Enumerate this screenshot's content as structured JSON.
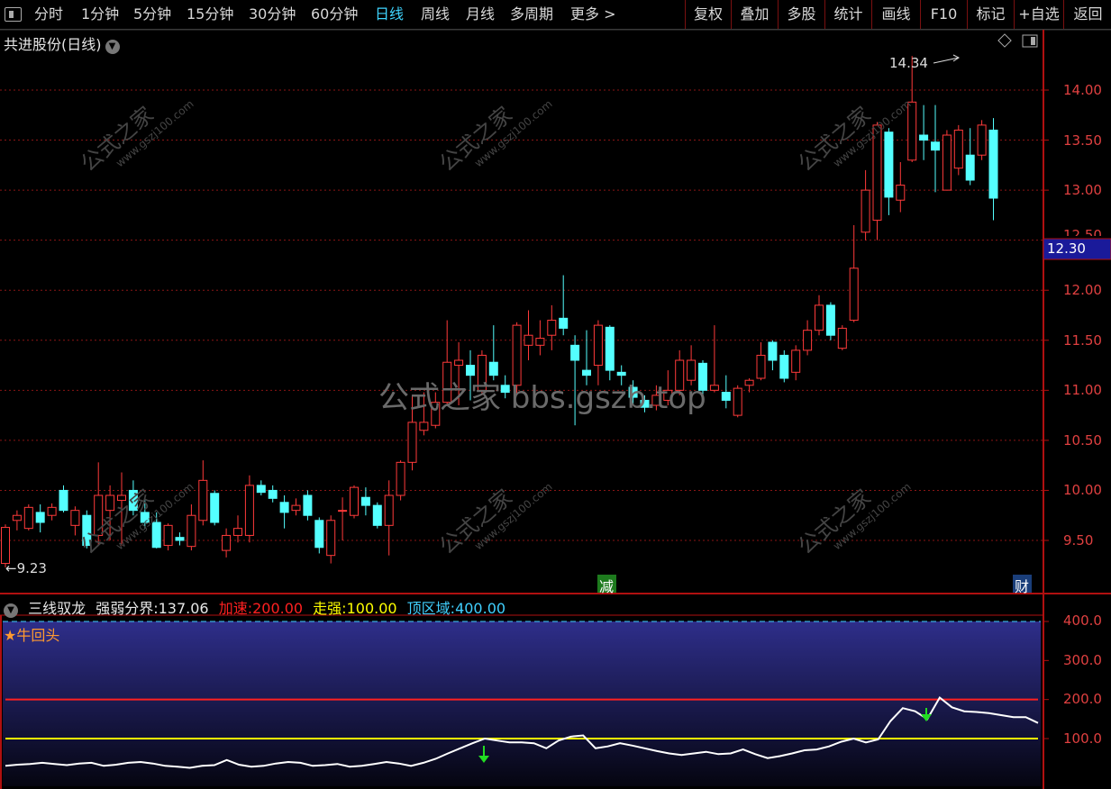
{
  "toolbar": {
    "periods": [
      "分时",
      "1分钟",
      "5分钟",
      "15分钟",
      "30分钟",
      "60分钟",
      "日线",
      "周线",
      "月线",
      "多周期",
      "更多 >"
    ],
    "active_period": "日线",
    "right_buttons": [
      "复权",
      "叠加",
      "多股",
      "统计",
      "画线",
      "F10",
      "标记",
      "+自选",
      "返回"
    ]
  },
  "main_chart": {
    "stock_name": "共进股份(日线)",
    "high_label": "14.34",
    "low_label": "←9.23",
    "current_price_tag": "12.30",
    "event_tag_jian": "减",
    "event_tag_cai": "财",
    "price_axis": [
      "14.00",
      "13.50",
      "13.00",
      "12.50",
      "12.00",
      "11.50",
      "11.00",
      "10.50",
      "10.00",
      "9.50"
    ],
    "watermark_center": "公式之家 bbs.gszb.top",
    "watermark_tile": "公式之家",
    "watermark_tile_url": "www.gszj100.com"
  },
  "indicator": {
    "name": "三线驭龙",
    "items": [
      {
        "label": "强弱分界:",
        "value": "137.06",
        "color": "#e8e8e8"
      },
      {
        "label": "加速:",
        "value": "200.00",
        "color": "#ff2020"
      },
      {
        "label": "走强:",
        "value": "100.00",
        "color": "#ffff00"
      },
      {
        "label": "顶区域:",
        "value": "400.00",
        "color": "#40d0ff"
      }
    ],
    "signal_label": "★牛回头",
    "axis": [
      "400.0",
      "300.0",
      "200.0",
      "100.0"
    ]
  },
  "chart_data": {
    "type": "candlestick",
    "ylim": [
      9.1,
      14.5
    ],
    "candles": [
      {
        "o": 9.27,
        "c": 9.63,
        "h": 9.66,
        "l": 9.23
      },
      {
        "o": 9.7,
        "c": 9.75,
        "h": 9.8,
        "l": 9.6
      },
      {
        "o": 9.62,
        "c": 9.83,
        "h": 9.86,
        "l": 9.6
      },
      {
        "o": 9.78,
        "c": 9.68,
        "h": 9.86,
        "l": 9.58
      },
      {
        "o": 9.75,
        "c": 9.83,
        "h": 9.87,
        "l": 9.7
      },
      {
        "o": 10.0,
        "c": 9.8,
        "h": 10.05,
        "l": 9.78
      },
      {
        "o": 9.65,
        "c": 9.8,
        "h": 9.84,
        "l": 9.55
      },
      {
        "o": 9.75,
        "c": 9.45,
        "h": 9.8,
        "l": 9.42
      },
      {
        "o": 9.55,
        "c": 9.95,
        "h": 10.28,
        "l": 9.45
      },
      {
        "o": 9.8,
        "c": 9.95,
        "h": 10.05,
        "l": 9.5
      },
      {
        "o": 9.9,
        "c": 9.95,
        "h": 10.18,
        "l": 9.45
      },
      {
        "o": 10.0,
        "c": 9.8,
        "h": 10.1,
        "l": 9.75
      },
      {
        "o": 9.78,
        "c": 9.68,
        "h": 9.9,
        "l": 9.62
      },
      {
        "o": 9.68,
        "c": 9.43,
        "h": 9.78,
        "l": 9.42
      },
      {
        "o": 9.45,
        "c": 9.65,
        "h": 9.67,
        "l": 9.4
      },
      {
        "o": 9.53,
        "c": 9.5,
        "h": 9.58,
        "l": 9.45
      },
      {
        "o": 9.44,
        "c": 9.75,
        "h": 9.86,
        "l": 9.4
      },
      {
        "o": 9.7,
        "c": 10.1,
        "h": 10.3,
        "l": 9.65
      },
      {
        "o": 9.97,
        "c": 9.68,
        "h": 10.0,
        "l": 9.65
      },
      {
        "o": 9.4,
        "c": 9.55,
        "h": 9.62,
        "l": 9.33
      },
      {
        "o": 9.55,
        "c": 9.62,
        "h": 9.75,
        "l": 9.48
      },
      {
        "o": 9.55,
        "c": 10.05,
        "h": 10.15,
        "l": 9.48
      },
      {
        "o": 10.05,
        "c": 9.98,
        "h": 10.1,
        "l": 9.95
      },
      {
        "o": 10.0,
        "c": 9.92,
        "h": 10.05,
        "l": 9.88
      },
      {
        "o": 9.88,
        "c": 9.78,
        "h": 9.95,
        "l": 9.62
      },
      {
        "o": 9.8,
        "c": 9.85,
        "h": 9.92,
        "l": 9.75
      },
      {
        "o": 9.95,
        "c": 9.75,
        "h": 10.0,
        "l": 9.7
      },
      {
        "o": 9.7,
        "c": 9.43,
        "h": 9.73,
        "l": 9.37
      },
      {
        "o": 9.35,
        "c": 9.7,
        "h": 9.75,
        "l": 9.27
      },
      {
        "o": 9.8,
        "c": 9.8,
        "h": 9.93,
        "l": 9.5
      },
      {
        "o": 9.75,
        "c": 10.03,
        "h": 10.05,
        "l": 9.72
      },
      {
        "o": 9.93,
        "c": 9.85,
        "h": 10.03,
        "l": 9.75
      },
      {
        "o": 9.85,
        "c": 9.65,
        "h": 9.88,
        "l": 9.62
      },
      {
        "o": 9.65,
        "c": 9.95,
        "h": 10.1,
        "l": 9.35
      },
      {
        "o": 9.95,
        "c": 10.28,
        "h": 10.3,
        "l": 9.9
      },
      {
        "o": 10.28,
        "c": 10.68,
        "h": 10.95,
        "l": 10.2
      },
      {
        "o": 10.6,
        "c": 10.68,
        "h": 10.98,
        "l": 10.55
      },
      {
        "o": 10.65,
        "c": 10.88,
        "h": 10.98,
        "l": 10.62
      },
      {
        "o": 10.88,
        "c": 11.28,
        "h": 11.7,
        "l": 10.85
      },
      {
        "o": 11.25,
        "c": 11.3,
        "h": 11.48,
        "l": 10.85
      },
      {
        "o": 11.25,
        "c": 11.15,
        "h": 11.4,
        "l": 10.9
      },
      {
        "o": 11.0,
        "c": 11.35,
        "h": 11.4,
        "l": 10.95
      },
      {
        "o": 11.28,
        "c": 11.15,
        "h": 11.65,
        "l": 11.1
      },
      {
        "o": 11.05,
        "c": 10.98,
        "h": 11.15,
        "l": 10.92
      },
      {
        "o": 11.05,
        "c": 11.65,
        "h": 11.68,
        "l": 10.95
      },
      {
        "o": 11.45,
        "c": 11.55,
        "h": 11.8,
        "l": 11.3
      },
      {
        "o": 11.45,
        "c": 11.52,
        "h": 11.7,
        "l": 11.35
      },
      {
        "o": 11.55,
        "c": 11.7,
        "h": 11.85,
        "l": 11.4
      },
      {
        "o": 11.72,
        "c": 11.62,
        "h": 12.15,
        "l": 11.55
      },
      {
        "o": 11.45,
        "c": 11.3,
        "h": 11.55,
        "l": 10.65
      },
      {
        "o": 11.2,
        "c": 11.15,
        "h": 11.6,
        "l": 11.05
      },
      {
        "o": 11.25,
        "c": 11.65,
        "h": 11.7,
        "l": 11.05
      },
      {
        "o": 11.63,
        "c": 11.2,
        "h": 11.65,
        "l": 11.1
      },
      {
        "o": 11.18,
        "c": 11.15,
        "h": 11.25,
        "l": 11.05
      },
      {
        "o": 11.03,
        "c": 10.93,
        "h": 11.1,
        "l": 10.85
      },
      {
        "o": 10.9,
        "c": 10.83,
        "h": 10.95,
        "l": 10.78
      },
      {
        "o": 10.85,
        "c": 10.95,
        "h": 11.05,
        "l": 10.8
      },
      {
        "o": 10.9,
        "c": 11.0,
        "h": 11.2,
        "l": 10.85
      },
      {
        "o": 11.0,
        "c": 11.3,
        "h": 11.4,
        "l": 10.95
      },
      {
        "o": 11.1,
        "c": 11.3,
        "h": 11.45,
        "l": 11.05
      },
      {
        "o": 11.27,
        "c": 11.0,
        "h": 11.3,
        "l": 10.95
      },
      {
        "o": 11.0,
        "c": 11.05,
        "h": 11.65,
        "l": 10.98
      },
      {
        "o": 10.98,
        "c": 10.9,
        "h": 11.15,
        "l": 10.82
      },
      {
        "o": 10.75,
        "c": 11.02,
        "h": 11.05,
        "l": 10.73
      },
      {
        "o": 11.05,
        "c": 11.1,
        "h": 11.12,
        "l": 10.98
      },
      {
        "o": 11.12,
        "c": 11.35,
        "h": 11.48,
        "l": 11.1
      },
      {
        "o": 11.48,
        "c": 11.3,
        "h": 11.5,
        "l": 11.2
      },
      {
        "o": 11.35,
        "c": 11.12,
        "h": 11.4,
        "l": 11.08
      },
      {
        "o": 11.18,
        "c": 11.4,
        "h": 11.45,
        "l": 11.1
      },
      {
        "o": 11.4,
        "c": 11.6,
        "h": 11.7,
        "l": 11.35
      },
      {
        "o": 11.6,
        "c": 11.85,
        "h": 11.95,
        "l": 11.55
      },
      {
        "o": 11.85,
        "c": 11.55,
        "h": 11.88,
        "l": 11.5
      },
      {
        "o": 11.42,
        "c": 11.62,
        "h": 11.65,
        "l": 11.4
      },
      {
        "o": 11.7,
        "c": 12.22,
        "h": 12.65,
        "l": 11.68
      },
      {
        "o": 12.58,
        "c": 13.0,
        "h": 13.2,
        "l": 12.5
      },
      {
        "o": 12.7,
        "c": 13.65,
        "h": 13.68,
        "l": 12.5
      },
      {
        "o": 13.58,
        "c": 12.93,
        "h": 13.62,
        "l": 12.75
      },
      {
        "o": 12.9,
        "c": 13.05,
        "h": 13.28,
        "l": 12.78
      },
      {
        "o": 13.3,
        "c": 13.88,
        "h": 14.34,
        "l": 13.28
      },
      {
        "o": 13.55,
        "c": 13.5,
        "h": 13.85,
        "l": 13.3
      },
      {
        "o": 13.48,
        "c": 13.4,
        "h": 13.85,
        "l": 12.98
      },
      {
        "o": 13.0,
        "c": 13.55,
        "h": 13.6,
        "l": 13.0
      },
      {
        "o": 13.22,
        "c": 13.6,
        "h": 13.65,
        "l": 13.15
      },
      {
        "o": 13.35,
        "c": 13.1,
        "h": 13.62,
        "l": 13.05
      },
      {
        "o": 13.35,
        "c": 13.65,
        "h": 13.7,
        "l": 13.3
      },
      {
        "o": 13.6,
        "c": 12.92,
        "h": 13.72,
        "l": 12.7
      }
    ],
    "indicator_ylim": [
      0,
      440
    ],
    "indicator_lines": {
      "acceleration": 200,
      "strong": 100,
      "top_zone": 400
    },
    "strength_line": [
      30,
      33,
      35,
      38,
      35,
      32,
      36,
      38,
      30,
      33,
      38,
      40,
      36,
      30,
      28,
      25,
      30,
      32,
      45,
      33,
      28,
      30,
      36,
      40,
      38,
      30,
      32,
      35,
      28,
      30,
      35,
      40,
      36,
      30,
      38,
      48,
      62,
      75,
      88,
      100,
      95,
      90,
      90,
      88,
      75,
      95,
      105,
      108,
      75,
      80,
      88,
      82,
      75,
      68,
      62,
      58,
      62,
      66,
      60,
      62,
      72,
      60,
      50,
      55,
      62,
      70,
      72,
      80,
      92,
      100,
      90,
      98,
      145,
      178,
      170,
      150,
      205,
      180,
      170,
      168,
      165,
      160,
      155,
      155,
      140
    ]
  }
}
